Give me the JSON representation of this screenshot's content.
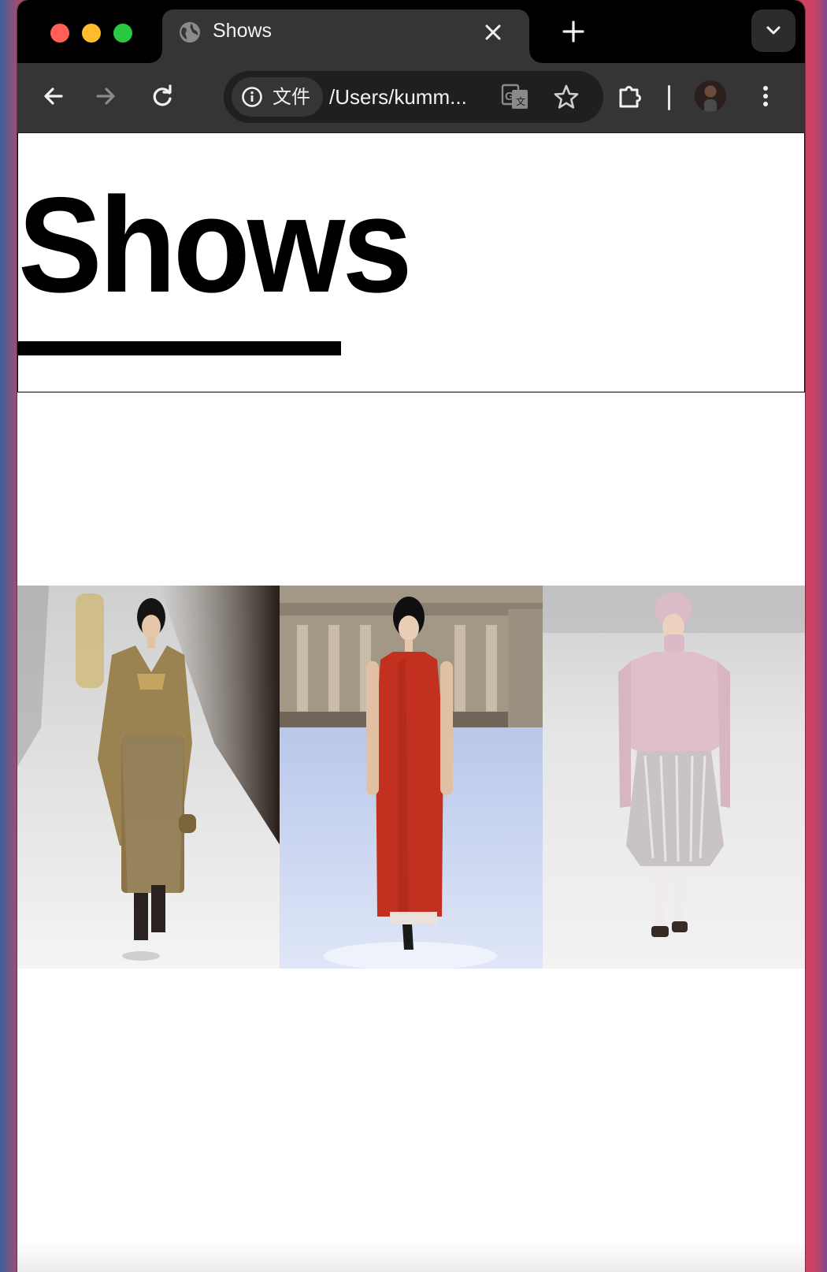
{
  "browser": {
    "tab": {
      "title": "Shows",
      "favicon": "globe-icon"
    },
    "address_bar": {
      "security_chip_label": "文件",
      "url": "/Users/kumm..."
    },
    "toolbar_icons": [
      "back-arrow-icon",
      "forward-arrow-icon",
      "reload-icon",
      "info-icon",
      "translate-icon",
      "star-icon",
      "extensions-icon",
      "profile-avatar",
      "more-menu-icon"
    ]
  },
  "page": {
    "title": "Shows",
    "gallery": [
      {
        "label": "Model in gold tweed jacket, bralette and metallic skirt",
        "dominant_color": "#a38f61"
      },
      {
        "label": "Model in red sleeveless column dress",
        "dominant_color": "#c43228"
      },
      {
        "label": "Model in pink beanie, knit sweater and sequin skirt",
        "dominant_color": "#e6c9d3"
      }
    ]
  },
  "colors": {
    "tabstrip": "#000000",
    "toolbar": "#353535",
    "omnibox": "#1f1f1f",
    "page_background": "#ffffff"
  }
}
